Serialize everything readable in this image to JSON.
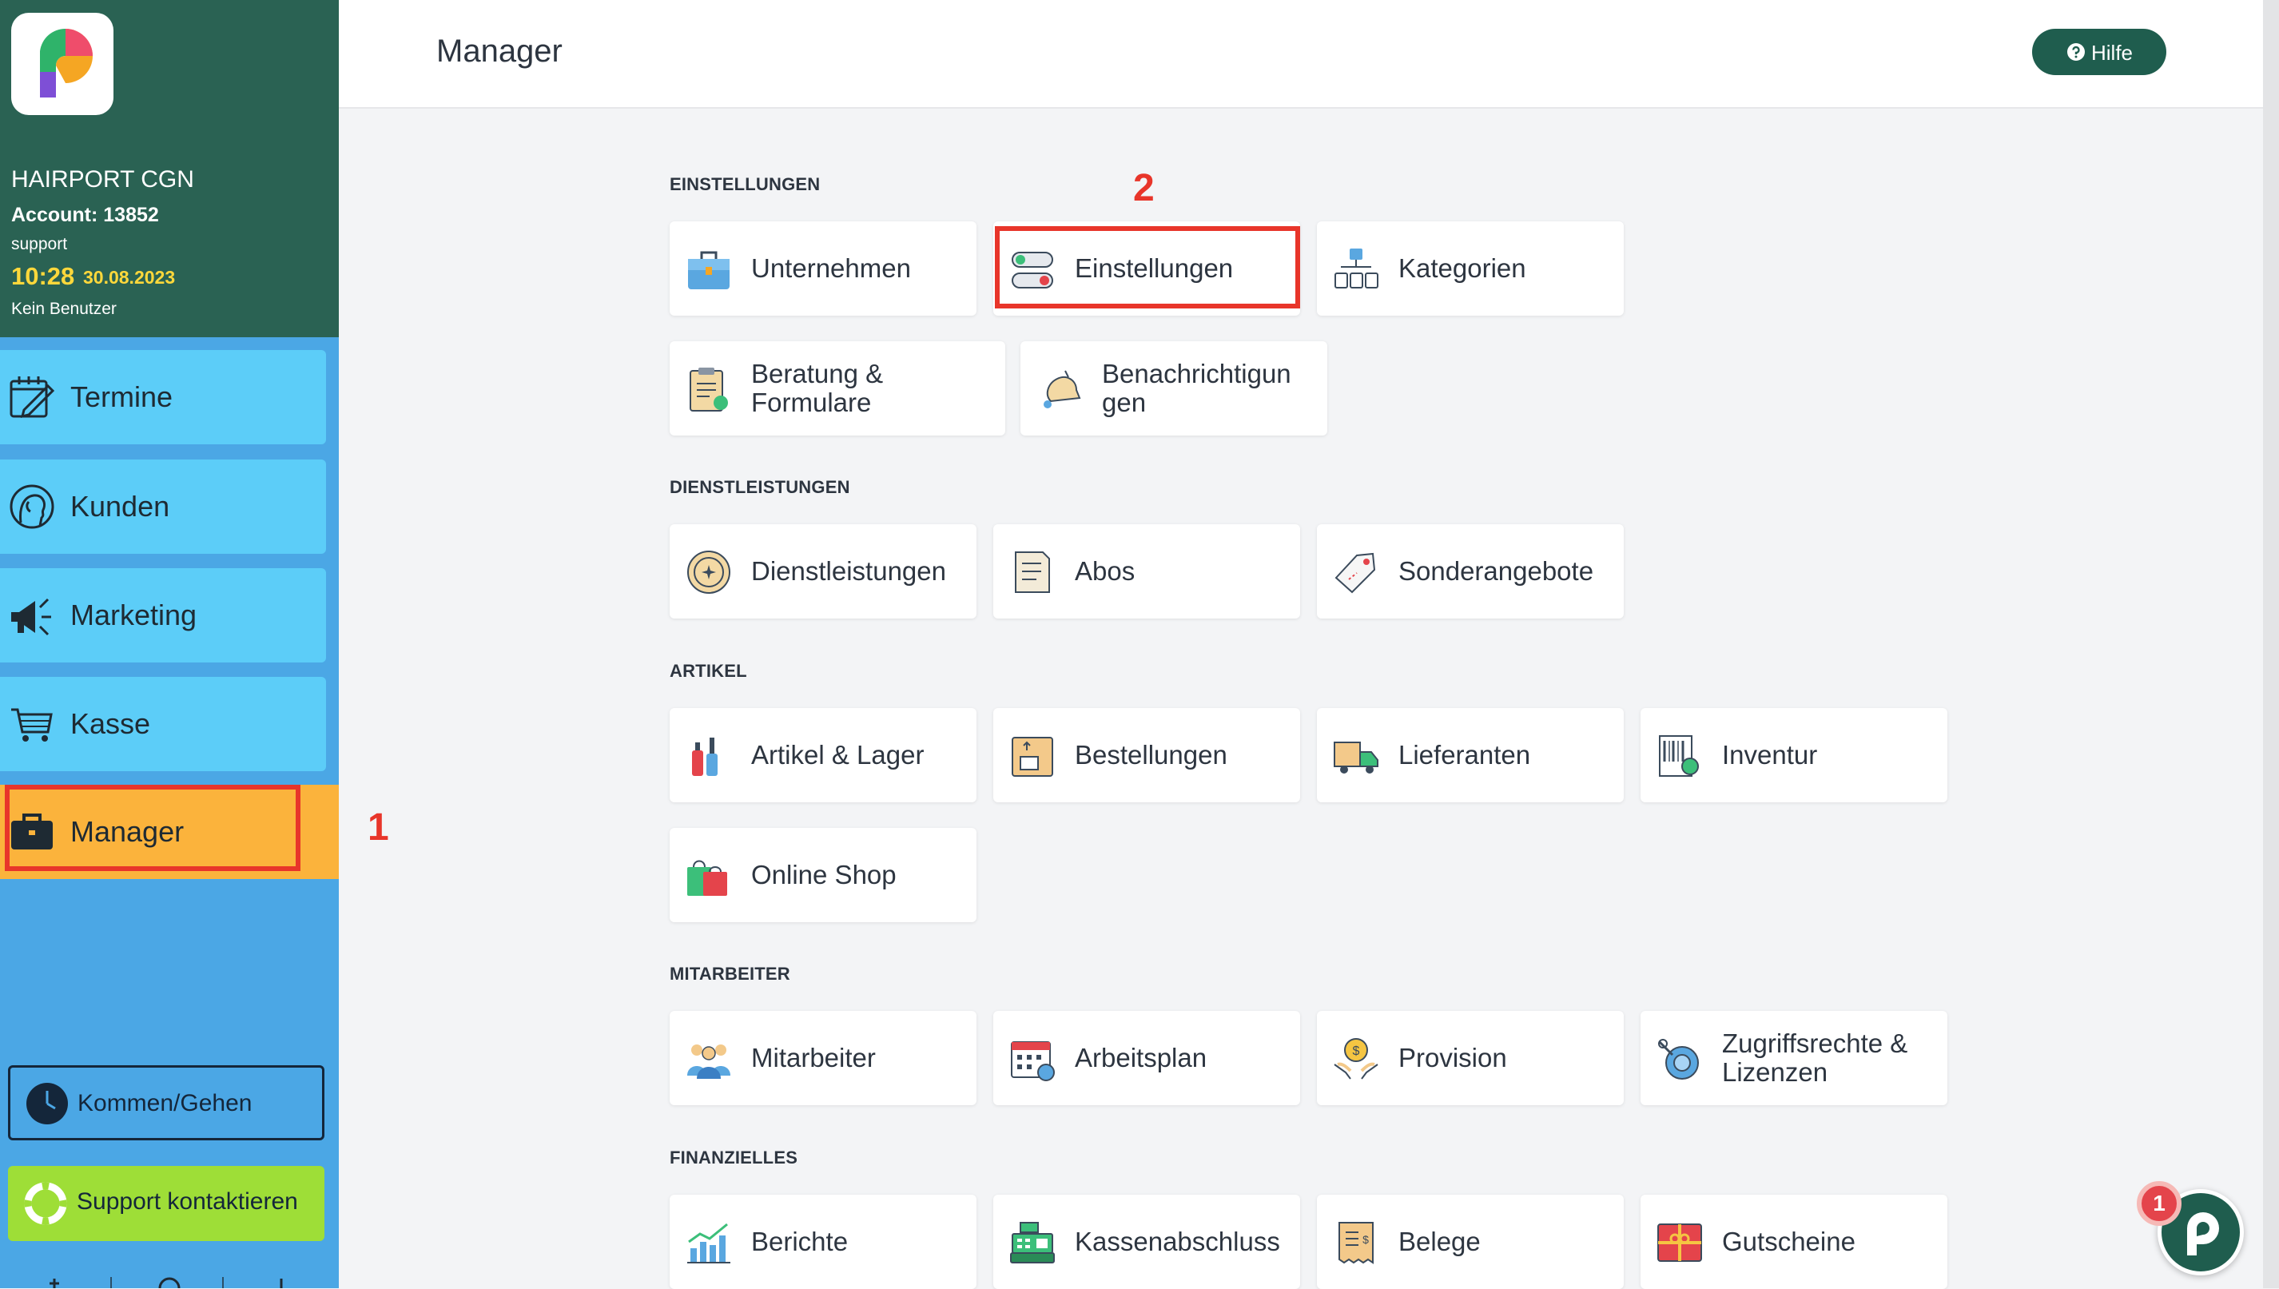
{
  "sidebar": {
    "company": "HAIRPORT CGN",
    "account": "Account: 13852",
    "user": "support",
    "time": "10:28",
    "date": "30.08.2023",
    "no_user": "Kein Benutzer",
    "nav": [
      {
        "label": "Termine",
        "icon": "calendar-edit-icon"
      },
      {
        "label": "Kunden",
        "icon": "customer-head-icon"
      },
      {
        "label": "Marketing",
        "icon": "megaphone-icon"
      },
      {
        "label": "Kasse",
        "icon": "cart-icon"
      },
      {
        "label": "Manager",
        "icon": "briefcase-icon",
        "active": true
      }
    ],
    "clock_button": "Kommen/Gehen",
    "support_button": "Support kontaktieren"
  },
  "header": {
    "title": "Manager",
    "help_label": "Hilfe"
  },
  "annotations": {
    "marker1": "1",
    "marker2": "2"
  },
  "sections": [
    {
      "title": "EINSTELLUNGEN",
      "tiles": [
        "Unternehmen",
        "Einstellungen",
        "Kategorien",
        "Beratung & Formulare",
        "Benachrichtigun gen"
      ]
    },
    {
      "title": "DIENSTLEISTUNGEN",
      "tiles": [
        "Dienstleistungen",
        "Abos",
        "Sonderangebote"
      ]
    },
    {
      "title": "ARTIKEL",
      "tiles": [
        "Artikel & Lager",
        "Bestellungen",
        "Lieferanten",
        "Inventur",
        "Online Shop"
      ]
    },
    {
      "title": "MITARBEITER",
      "tiles": [
        "Mitarbeiter",
        "Arbeitsplan",
        "Provision",
        "Zugriffsrechte & Lizenzen"
      ]
    },
    {
      "title": "FINANZIELLES",
      "tiles": [
        "Berichte",
        "Kassenabschluss",
        "Belege",
        "Gutscheine"
      ]
    }
  ],
  "chat": {
    "badge": "1"
  },
  "colors": {
    "sidebar_header": "#2a6253",
    "sidebar_bg": "#4ba7e5",
    "nav_item": "#5ccdf8",
    "nav_active": "#fbb33c",
    "highlight": "#e8352a",
    "help_button": "#1f5d4e",
    "support_button": "#9ede37"
  }
}
